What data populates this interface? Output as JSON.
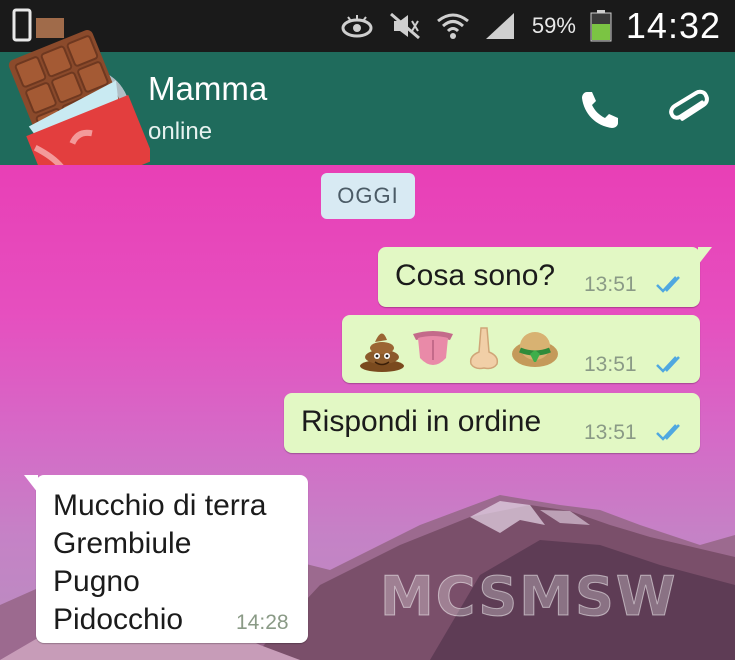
{
  "status_bar": {
    "battery_percent": "59%",
    "time": "14:32",
    "icons": [
      "phone-screenshot-icon",
      "eye-icon",
      "mute-icon",
      "wifi-icon",
      "signal-icon",
      "battery-icon"
    ]
  },
  "header": {
    "contact_name": "Mamma",
    "contact_status": "online",
    "actions": [
      "phone-icon",
      "paperclip-icon"
    ]
  },
  "chat": {
    "date_chip": "OGGI",
    "messages": [
      {
        "direction": "out",
        "text": "Cosa sono?",
        "time": "13:51",
        "status": "read"
      },
      {
        "direction": "out",
        "emojis": [
          "pile-of-poo",
          "tongue",
          "nose",
          "hat"
        ],
        "time": "13:51",
        "status": "read"
      },
      {
        "direction": "out",
        "text": "Rispondi in ordine",
        "time": "13:51",
        "status": "read"
      },
      {
        "direction": "in",
        "lines": [
          "Mucchio di terra",
          "Grembiule",
          "Pugno",
          "Pidocchio"
        ],
        "time": "14:28"
      }
    ],
    "watermark": "MCSMSW"
  },
  "colors": {
    "app_bar": "#1f6b5c",
    "outgoing_bubble": "#e2f8c4",
    "incoming_bubble": "#ffffff",
    "read_ticks": "#4fa8e0"
  }
}
